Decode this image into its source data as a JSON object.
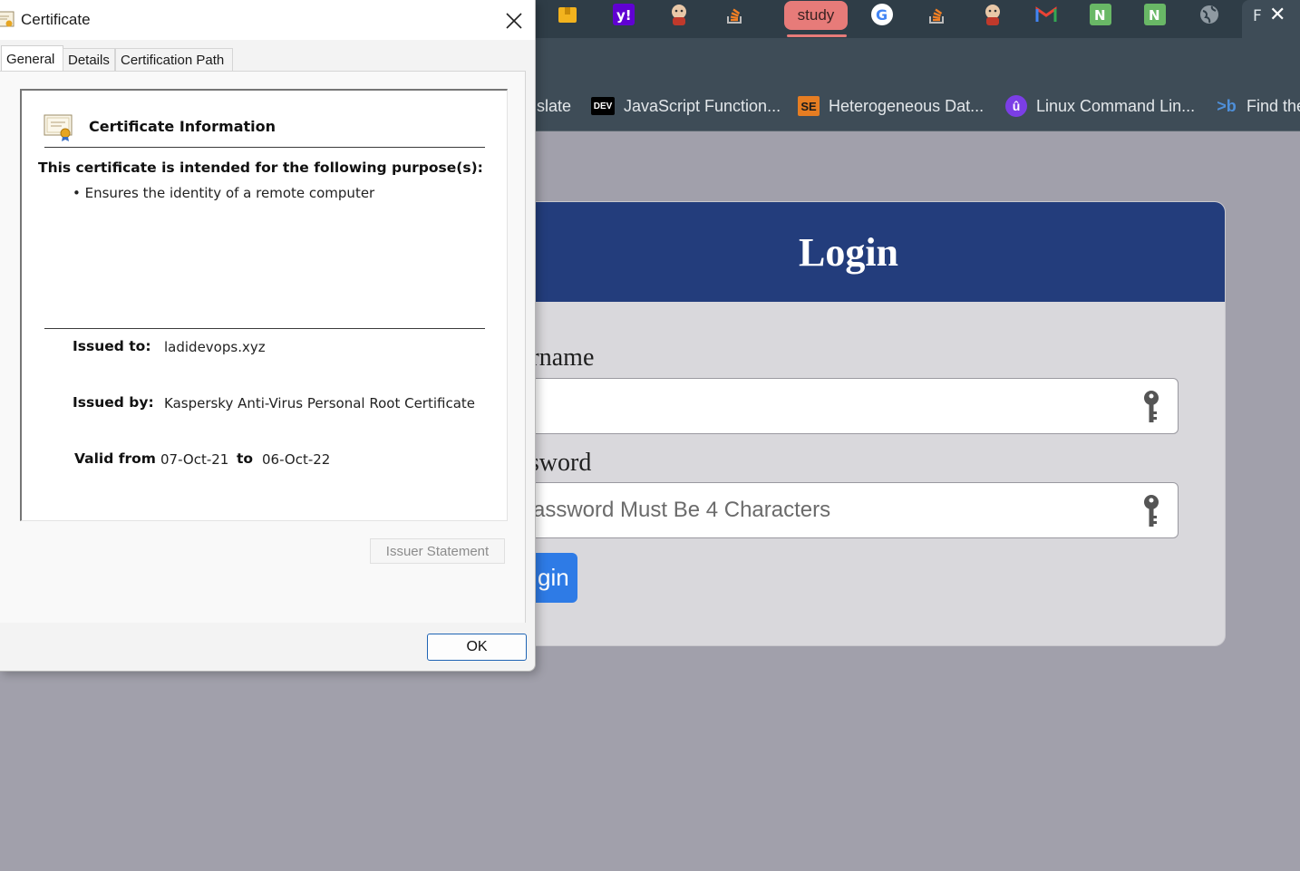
{
  "browser": {
    "tabs": [
      {
        "icon": "amazon-box-icon",
        "text": ""
      },
      {
        "icon": "yahoo-icon",
        "text": ""
      },
      {
        "icon": "jenkins-icon",
        "text": ""
      },
      {
        "icon": "stackoverflow-icon",
        "text": ""
      },
      {
        "icon": "",
        "text": "study"
      },
      {
        "icon": "google-icon",
        "text": ""
      },
      {
        "icon": "stackoverflow-icon",
        "text": ""
      },
      {
        "icon": "jenkins-icon",
        "text": ""
      },
      {
        "icon": "gmail-icon",
        "text": ""
      },
      {
        "icon": "n-icon",
        "text": ""
      },
      {
        "icon": "n-icon",
        "text": ""
      },
      {
        "icon": "globe-icon",
        "text": ""
      }
    ],
    "active_tab_letter": "F",
    "active_tab_close": "✕",
    "bookmarks": [
      {
        "text": "slate"
      },
      {
        "icon_text": "DEV",
        "text": "JavaScript Function..."
      },
      {
        "icon_text": "SE",
        "text": "Heterogeneous Dat..."
      },
      {
        "icon_text": "û",
        "text": "Linux Command Lin..."
      },
      {
        "icon_text": ">b",
        "text": "Find the"
      }
    ]
  },
  "login": {
    "title": "Login",
    "username_label": "ername",
    "username_placeholder": "",
    "password_label": "ssword",
    "password_placeholder": "assword Must Be 4 Characters",
    "button_label": "gin"
  },
  "cert": {
    "window_title": "Certificate",
    "tabs": [
      "General",
      "Details",
      "Certification Path"
    ],
    "active_tab": "General",
    "info_title": "Certificate Information",
    "purpose_heading": "This certificate is intended for the following purpose(s):",
    "purpose_items": [
      "• Ensures the identity of a remote computer"
    ],
    "issued_to_label": "Issued to:",
    "issued_to": "ladidevops.xyz",
    "issued_by_label": "Issued by:",
    "issued_by": "Kaspersky Anti-Virus Personal Root Certificate",
    "valid_from_label": "Valid from",
    "valid_from": "07-Oct-21",
    "to_label": "to",
    "valid_to": "06-Oct-22",
    "issuer_statement_label": "Issuer Statement",
    "ok_label": "OK"
  },
  "colors": {
    "login_header": "#233d7c",
    "login_button": "#2e7be6",
    "study_tab": "#e77b79",
    "chrome_bg": "#3e4c57"
  }
}
